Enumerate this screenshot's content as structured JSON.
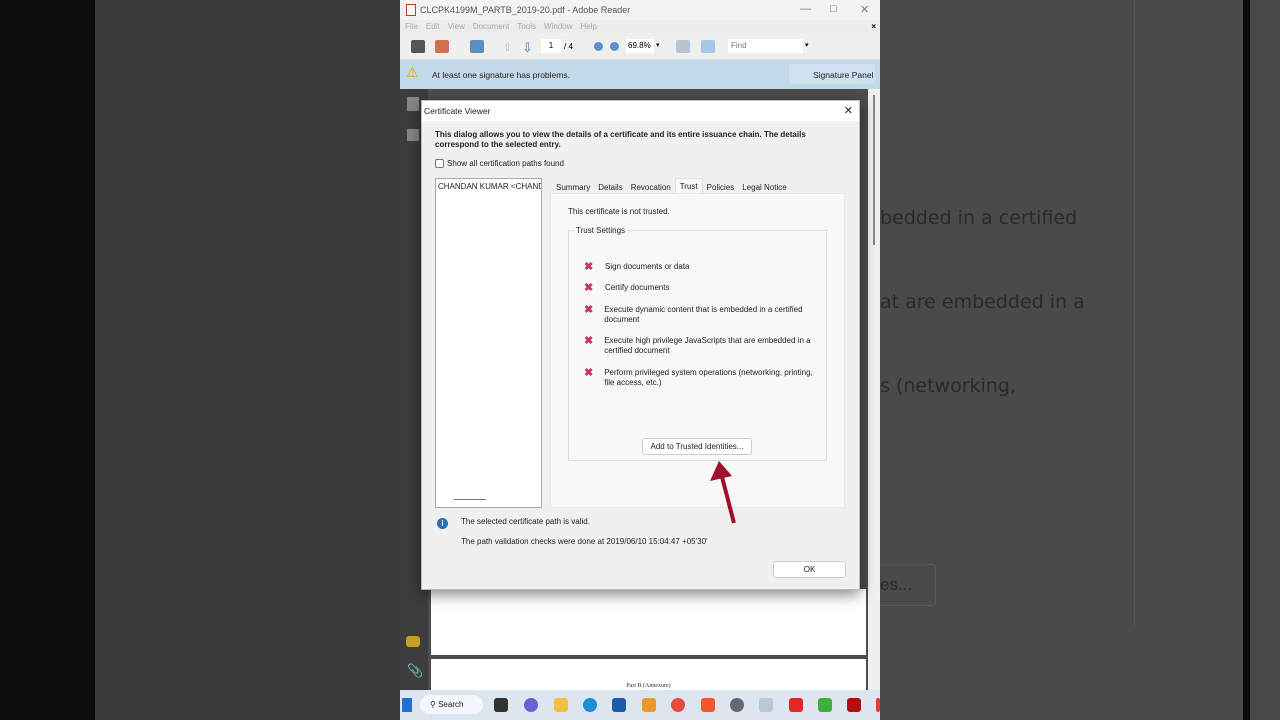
{
  "background": {
    "fragments": [
      "bedded in a certified",
      "at are embedded in a",
      "s (networking,",
      "es..."
    ]
  },
  "window": {
    "title": "CLCPK4199M_PARTB_2019-20.pdf - Adobe Reader",
    "menu": [
      "File",
      "Edit",
      "View",
      "Document",
      "Tools",
      "Window",
      "Help"
    ],
    "toolbar": {
      "page_current": "1",
      "page_total": "/ 4",
      "zoom": "69.8%",
      "find_placeholder": "Find"
    },
    "signature_bar": {
      "message": "At least one signature has problems.",
      "panel_button": "Signature Panel"
    },
    "page_text": "Part B (Annexure)"
  },
  "dialog": {
    "title": "Certificate Viewer",
    "intro": "This dialog allows you to view the details of a certificate and its entire issuance chain. The details correspond to the selected entry.",
    "show_all_label": "Show all certification paths found",
    "show_all_checked": false,
    "tree_entry": "CHANDAN KUMAR <CHAND",
    "tabs": [
      "Summary",
      "Details",
      "Revocation",
      "Trust",
      "Policies",
      "Legal Notice"
    ],
    "active_tab": "Trust",
    "trust_status": "This certificate is not trusted.",
    "trust_settings_label": "Trust Settings",
    "trust_items": [
      "Sign documents or data",
      "Certify documents",
      "Execute dynamic content that is embedded in a certified document",
      "Execute high privilege JavaScripts that are embedded in a certified document",
      "Perform privileged system operations (networking, printing, file access, etc.)"
    ],
    "add_button": "Add to Trusted Identities...",
    "path_valid": "The selected certificate path is valid.",
    "validation_time": "The path validation checks were done at 2019/06/10 15:04:47 +05'30'",
    "ok_button": "OK"
  },
  "taskbar": {
    "search_label": "Search"
  },
  "colors": {
    "x_mark": "#c0395a",
    "arrow": "#a0102a",
    "sigbar": "#c2d9ea"
  }
}
